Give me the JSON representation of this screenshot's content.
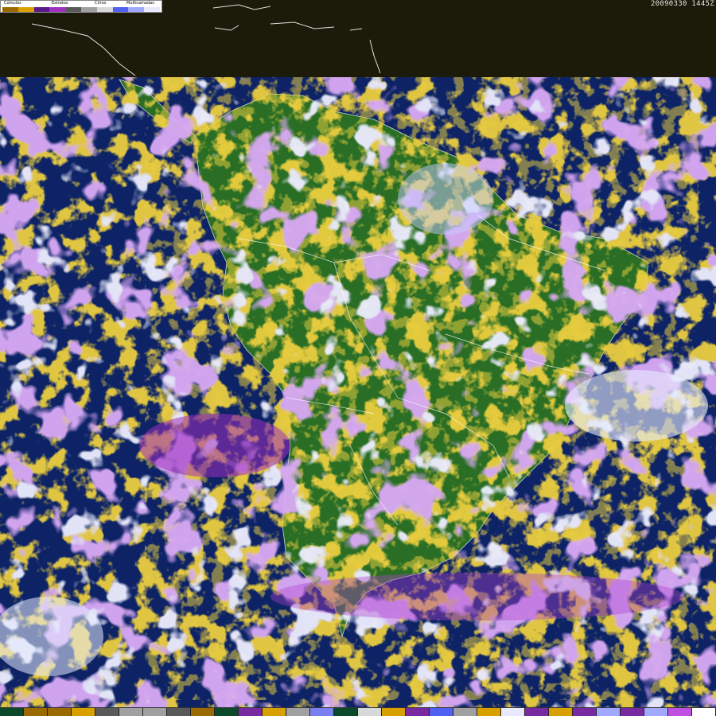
{
  "header": {
    "timestamp": "20090330 1445Z"
  },
  "legend": {
    "labels": [
      {
        "text": "Cúmulos"
      },
      {
        "text": "Estratos"
      },
      {
        "text": "Cirros"
      },
      {
        "text": "Multicamadas"
      }
    ],
    "swatch_colors": [
      "#9a6a00",
      "#d8a000",
      "#5a1a8a",
      "#a030c0",
      "#5a5a5a",
      "#a0a0a0",
      "#d8d8d8",
      "#5060f0",
      "#a0a8ff",
      "#e8e8ff"
    ]
  },
  "colors": {
    "ocean": "#0d2366",
    "top_band": "#1c1a08",
    "land_forest": "#1f6a1f",
    "land_grass": "#3f7f2f",
    "cumulus_dark": "#a07000",
    "cumulus_light": "#d4a000",
    "stratus_dark": "#7a2aa0",
    "stratus_light": "#c050e0",
    "cirrus_gray": "#9a9a9a",
    "multilayer_blue": "#8a90ff",
    "multilayer_white": "#eef0ff",
    "borders": "#ffffff"
  },
  "bottom_bar_colors": [
    "#0a4a2a",
    "#9a6a00",
    "#9a6a00",
    "#d8a000",
    "#5a5a5a",
    "#a0a0a0",
    "#a0a0a0",
    "#5a5a5a",
    "#9a6a00",
    "#0a4a2a",
    "#7a2aa0",
    "#d8a000",
    "#a0a0a0",
    "#7a80f0",
    "#0a4a2a",
    "#d8d8d8",
    "#d8a000",
    "#7a2aa0",
    "#5060f0",
    "#a0a0a0",
    "#d8a000",
    "#e8e8ff",
    "#7a2aa0",
    "#d8a000",
    "#7a2aa0",
    "#a0a8ff",
    "#7a2aa0",
    "#a0a8ff",
    "#c050e0",
    "#ffffff"
  ]
}
